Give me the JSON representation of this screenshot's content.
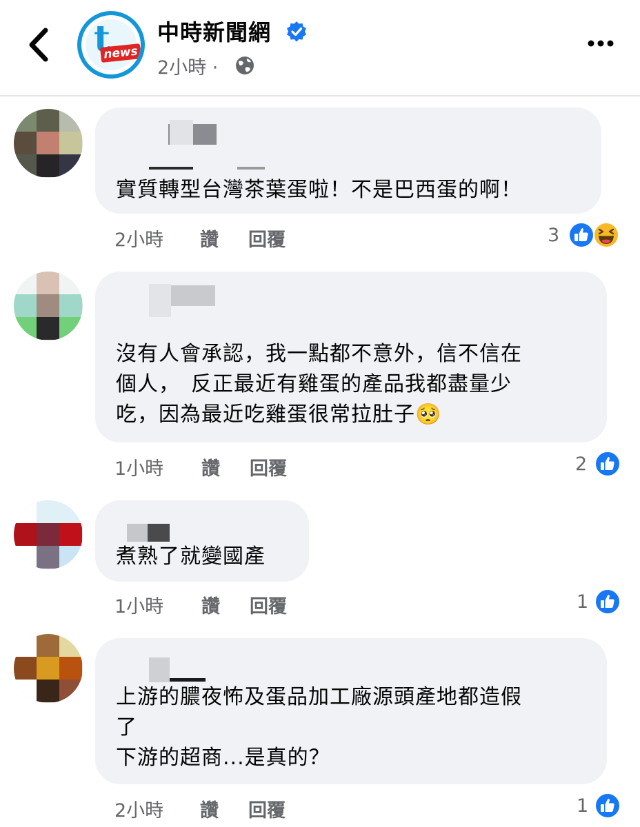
{
  "header": {
    "page_name": "中時新聞網",
    "post_time": "2小時",
    "separator": "·",
    "logo_text": "news"
  },
  "comments": [
    {
      "text": "實質轉型台灣茶葉蛋啦！不是巴西蛋的啊！",
      "time": "2小時",
      "like_label": "讚",
      "reply_label": "回覆",
      "reaction_count": "3",
      "reactions": [
        "like-icon",
        "haha-icon"
      ]
    },
    {
      "text": "沒有人會承認，我一點都不意外，信不信在\n個人，　反正最近有雞蛋的產品我都盡量少\n吃，因為最近吃雞蛋很常拉肚子🥺",
      "time": "1小時",
      "like_label": "讚",
      "reply_label": "回覆",
      "reaction_count": "2",
      "reactions": [
        "like-icon"
      ]
    },
    {
      "text": "煮熟了就變國產",
      "time": "1小時",
      "like_label": "讚",
      "reply_label": "回覆",
      "reaction_count": "1",
      "reactions": [
        "like-icon"
      ]
    },
    {
      "text": "上游的膿夜怖及蛋品加工廠源頭產地都造假\n了\n下游的超商...是真的？",
      "time": "2小時",
      "like_label": "讚",
      "reply_label": "回覆",
      "reaction_count": "1",
      "reactions": [
        "like-icon"
      ]
    }
  ],
  "colors": {
    "accent": "#1877f2",
    "bubble": "#f0f2f5",
    "meta_text": "#65676b",
    "haha": "#f7b928"
  }
}
